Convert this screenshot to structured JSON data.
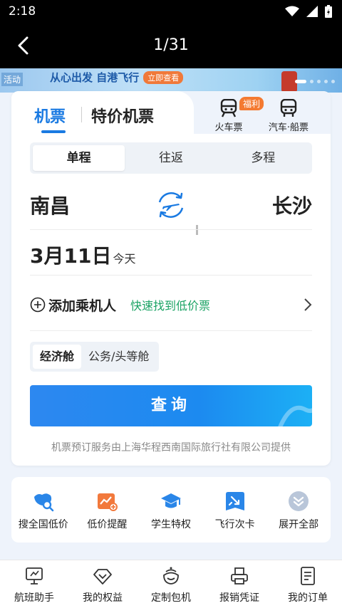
{
  "status_bar": {
    "time": "2:18"
  },
  "viewer": {
    "counter": "1/31"
  },
  "banner": {
    "tag": "活动",
    "text": "从心出发 自港飞行",
    "cta": "立即查看"
  },
  "tabs": {
    "flight": "机票",
    "special": "特价机票"
  },
  "transport": {
    "train": "火车票",
    "train_badge": "福利",
    "bus": "汽车·船票"
  },
  "trip_types": [
    "单程",
    "往返",
    "多程"
  ],
  "route": {
    "from": "南昌",
    "to": "长沙"
  },
  "date": {
    "date": "3月11日",
    "day": "今天"
  },
  "passenger": {
    "add": "添加乘机人",
    "hint": "快速找到低价票"
  },
  "cabins": [
    "经济舱",
    "公务/头等舱"
  ],
  "search_label": "查询",
  "provider_note": "机票预订服务由上海华程西南国际旅行社有限公司提供",
  "quick_actions": [
    {
      "label": "搜全国低价",
      "icon": "map-search-icon"
    },
    {
      "label": "低价提醒",
      "icon": "price-alert-icon"
    },
    {
      "label": "学生特权",
      "icon": "graduation-cap-icon"
    },
    {
      "label": "飞行次卡",
      "icon": "flight-pass-icon"
    },
    {
      "label": "展开全部",
      "icon": "expand-all-icon"
    }
  ],
  "bottom_nav": [
    {
      "label": "航班助手",
      "icon": "monitor-icon"
    },
    {
      "label": "我的权益",
      "icon": "diamond-icon"
    },
    {
      "label": "定制包机",
      "icon": "custom-charter-icon"
    },
    {
      "label": "报销凭证",
      "icon": "printer-icon"
    },
    {
      "label": "我的订单",
      "icon": "order-list-icon"
    }
  ],
  "colors": {
    "accent": "#1a7ae2",
    "hint_green": "#1aa364",
    "badge_orange": "#f47a31"
  }
}
